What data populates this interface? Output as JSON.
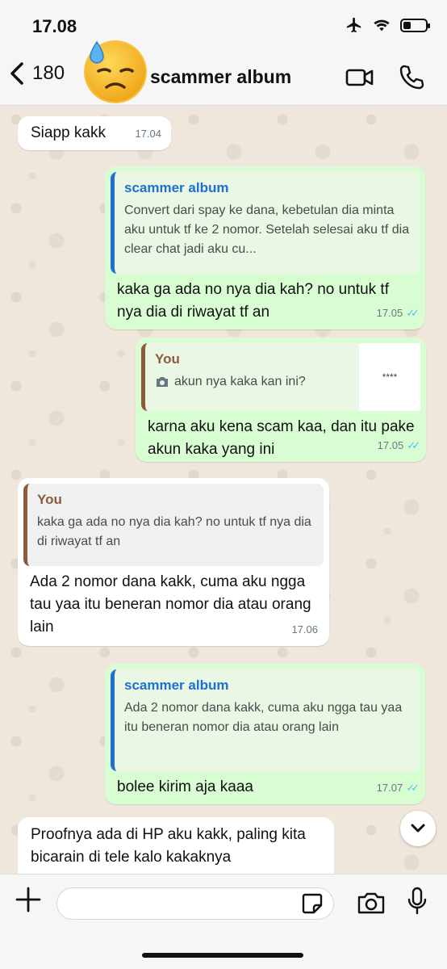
{
  "status": {
    "time": "17.08"
  },
  "header": {
    "back_count": "180",
    "contact_name": "scammer album"
  },
  "messages": [
    {
      "text": "Siapp kakk",
      "time": "17.04"
    },
    {
      "quote_author": "scammer album",
      "quote_text": "Convert dari spay ke dana, kebetulan dia minta aku untuk tf ke 2 nomor. Setelah selesai aku tf dia clear chat jadi aku cu...",
      "text": "kaka ga ada no nya dia kah? no untuk tf nya dia di riwayat tf an",
      "time": "17.05"
    },
    {
      "quote_author": "You",
      "quote_text": "akun nya kaka kan ini?",
      "quote_thumb_text": "****",
      "text": "karna aku kena scam kaa, dan itu pake akun kaka yang ini",
      "time": "17.05"
    },
    {
      "quote_author": "You",
      "quote_text": "kaka ga ada no nya dia kah? no untuk tf nya dia di riwayat tf an",
      "text": "Ada 2 nomor dana kakk, cuma aku ngga tau yaa itu beneran nomor dia atau orang lain",
      "time": "17.06"
    },
    {
      "quote_author": "scammer album",
      "quote_text": "Ada 2 nomor dana kakk, cuma aku ngga tau yaa itu beneran nomor dia atau orang lain",
      "text": "bolee kirim aja kaaa",
      "time": "17.07"
    },
    {
      "text": "Proofnya ada di HP aku kakk, paling kita bicarain di tele kalo kakaknya"
    }
  ]
}
